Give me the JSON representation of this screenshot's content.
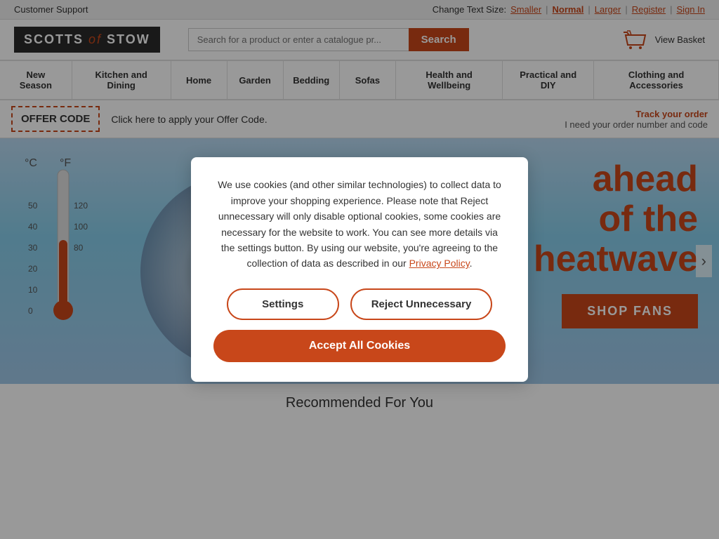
{
  "topbar": {
    "customer_support": "Customer Support",
    "change_text_size": "Change Text Size:",
    "smaller": "Smaller",
    "normal": "Normal",
    "larger": "Larger",
    "register": "Register",
    "sign_in": "Sign In"
  },
  "header": {
    "logo_part1": "SCOTTS",
    "logo_of": "of",
    "logo_part2": "STOW",
    "search_placeholder": "Search for a product or enter a catalogue pr...",
    "search_button": "Search",
    "view_basket": "View Basket"
  },
  "nav": {
    "items": [
      {
        "label": "New Season"
      },
      {
        "label": "Kitchen and Dining"
      },
      {
        "label": "Home"
      },
      {
        "label": "Garden"
      },
      {
        "label": "Bedding"
      },
      {
        "label": "Sofas"
      },
      {
        "label": "Health and Wellbeing"
      },
      {
        "label": "Practical and DIY"
      },
      {
        "label": "Clothing and Accessories"
      }
    ]
  },
  "offer": {
    "code_label": "OFFER CODE",
    "click_text": "Click here to apply your Offer Code.",
    "track_title": "Track your order",
    "track_sub": "I need your order number and code"
  },
  "hero": {
    "heading_line1": "ahead",
    "heading_line2": "of the",
    "heading_line3": "heatwave",
    "shop_button": "SHOP FANS"
  },
  "recommended": {
    "heading": "Recommended For You"
  },
  "cookie": {
    "body": "We use cookies (and other similar technologies) to collect data to improve your shopping experience. Please note that Reject unnecessary will only disable optional cookies, some cookies are necessary for the website to work. You can see more details via the settings button. By using our website, you're agreeing to the collection of data as described in our ",
    "privacy_policy_link": "Privacy Policy",
    "privacy_policy_period": ".",
    "settings_btn": "Settings",
    "reject_btn": "Reject Unnecessary",
    "accept_btn": "Accept All Cookies"
  }
}
